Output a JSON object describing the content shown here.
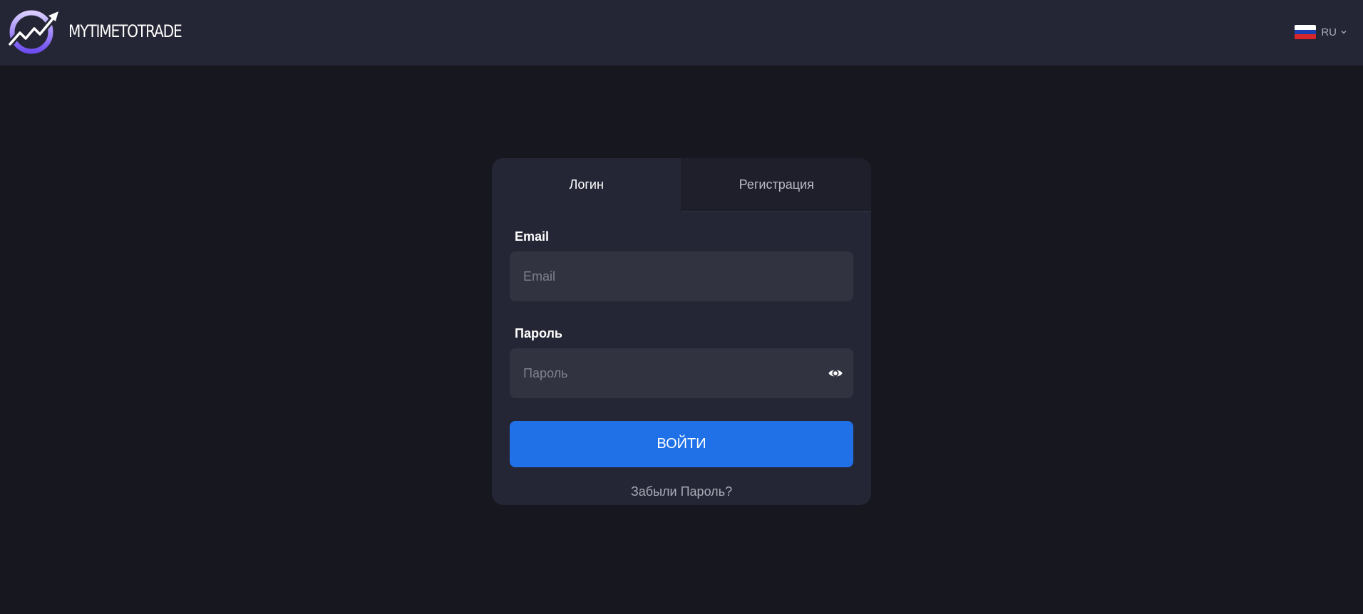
{
  "header": {
    "logo_text": "MYTIMETOTRADE",
    "language": {
      "code": "RU",
      "flag_colors": [
        "#ffffff",
        "#1c3fb0",
        "#d6262b"
      ]
    }
  },
  "auth_card": {
    "tabs": [
      {
        "label": "Логин",
        "active": true
      },
      {
        "label": "Регистрация",
        "active": false
      }
    ],
    "email": {
      "label": "Email",
      "placeholder": "Email",
      "value": ""
    },
    "password": {
      "label": "Пароль",
      "placeholder": "Пароль",
      "value": "",
      "toggle_icon": "eye-icon"
    },
    "submit_label": "ВОЙТИ",
    "forgot_label": "Забыли Пароль?"
  },
  "colors": {
    "background": "#17171f",
    "header": "#252635",
    "card": "#252635",
    "input": "#323341",
    "accent": "#2071e8",
    "logo_ring": "#8b6cf0"
  }
}
